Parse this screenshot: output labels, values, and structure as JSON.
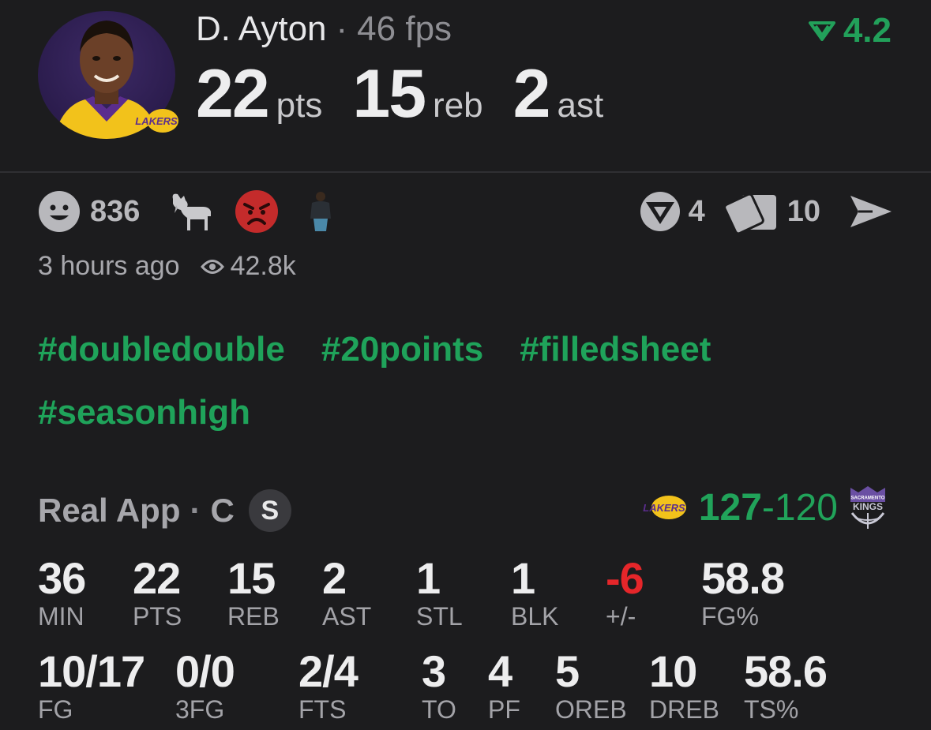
{
  "player": {
    "name": "D. Ayton",
    "dot": "·",
    "fps": "46 fps",
    "rating": "4.2",
    "headline": [
      {
        "value": "22",
        "unit": "pts"
      },
      {
        "value": "15",
        "unit": "reb"
      },
      {
        "value": "2",
        "unit": "ast"
      }
    ],
    "team_logo_text": "LAKERS"
  },
  "reactions": {
    "smile_count": "836",
    "icons": [
      "smile-icon",
      "goat-icon",
      "angry-face-icon",
      "person-sticker-icon"
    ]
  },
  "actions": {
    "prediction_count": "4",
    "cards_count": "10"
  },
  "meta": {
    "time_ago": "3 hours ago",
    "views": "42.8k"
  },
  "hashtags": [
    "#doubledouble",
    "#20points",
    "#filledsheet",
    "#seasonhigh"
  ],
  "game": {
    "app": "Real App",
    "sep": "·",
    "position": "C",
    "badge": "S",
    "home_logo": "LAKERS",
    "score_winner": "127",
    "score_dash": "-",
    "score_loser": "120",
    "away_logo": "KINGS",
    "away_logo_top": "SACRAMENTO"
  },
  "box_row1": [
    {
      "value": "36",
      "label": "MIN"
    },
    {
      "value": "22",
      "label": "PTS"
    },
    {
      "value": "15",
      "label": "REB"
    },
    {
      "value": "2",
      "label": "AST"
    },
    {
      "value": "1",
      "label": "STL"
    },
    {
      "value": "1",
      "label": "BLK"
    },
    {
      "value": "-6",
      "label": "+/-"
    },
    {
      "value": "58.8",
      "label": "FG%"
    }
  ],
  "box_row2": [
    {
      "value": "10/17",
      "label": "FG"
    },
    {
      "value": "0/0",
      "label": "3FG"
    },
    {
      "value": "2/4",
      "label": "FTS"
    },
    {
      "value": "3",
      "label": "TO"
    },
    {
      "value": "4",
      "label": "PF"
    },
    {
      "value": "5",
      "label": "OREB"
    },
    {
      "value": "10",
      "label": "DREB"
    },
    {
      "value": "58.6",
      "label": "TS%"
    }
  ],
  "colors": {
    "accent_green": "#1fa35a",
    "negative_red": "#e5262a",
    "background": "#1c1c1e"
  }
}
